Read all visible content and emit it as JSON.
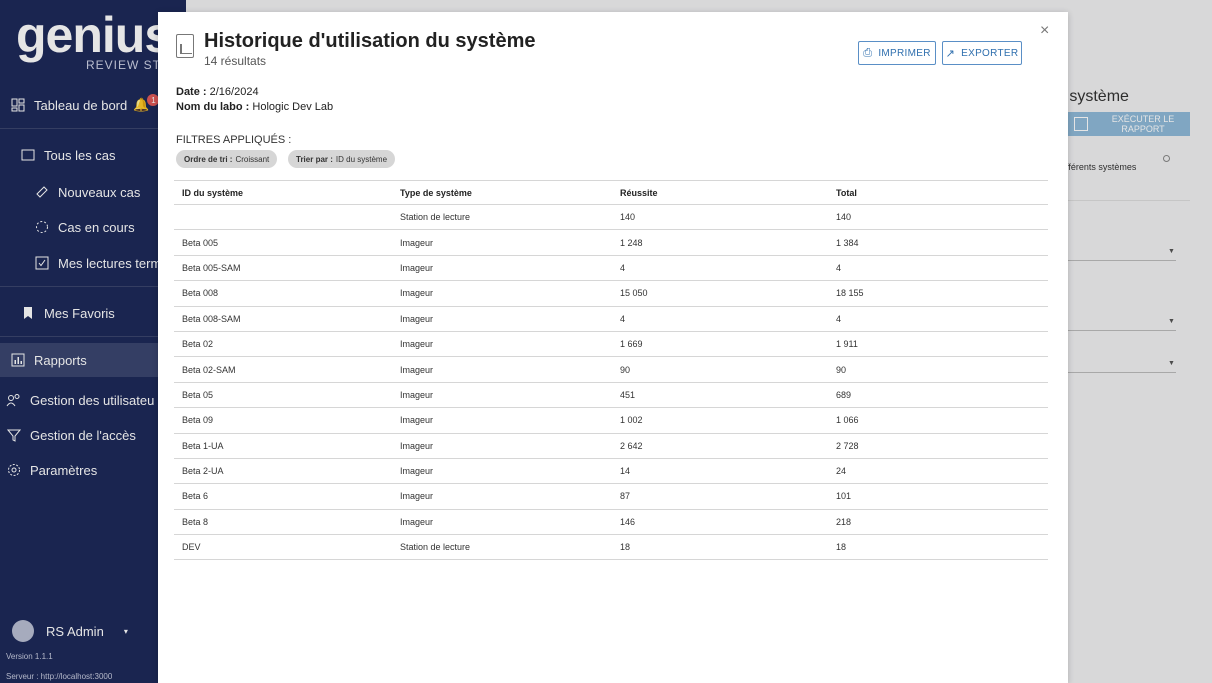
{
  "sidebar": {
    "logo": "genius",
    "logo_sub": "REVIEW STATIC",
    "items": [
      {
        "label": "Tableau de bord",
        "icon": "dashboard-icon"
      },
      {
        "label": "Tous les cas",
        "icon": "folder-icon"
      },
      {
        "label": "Nouveaux cas",
        "icon": "tag-icon"
      },
      {
        "label": "Cas en cours",
        "icon": "progress-icon"
      },
      {
        "label": "Mes lectures termi",
        "icon": "check-icon"
      },
      {
        "label": "Mes Favoris",
        "icon": "bookmark-icon"
      },
      {
        "label": "Rapports",
        "icon": "report-icon"
      },
      {
        "label": "Gestion des utilisateu",
        "icon": "users-icon"
      },
      {
        "label": "Gestion de l'accès",
        "icon": "filter-icon"
      },
      {
        "label": "Paramètres",
        "icon": "gear-icon"
      }
    ],
    "notification_count": "1",
    "user": "RS Admin",
    "version": "Version 1.1.1",
    "server": "Serveur : http://localhost:3000"
  },
  "background": {
    "title": "u système",
    "run_button": "EXÉCUTER LE RAPPORT",
    "option_text": "ifférents systèmes"
  },
  "modal": {
    "title": "Historique d'utilisation du système",
    "subtitle": "14 résultats",
    "print_label": "IMPRIMER",
    "export_label": "EXPORTER",
    "close": "×",
    "date_label": "Date :",
    "date_value": "2/16/2024",
    "lab_label": "Nom du labo :",
    "lab_value": "Hologic Dev Lab",
    "filters_label": "FILTRES APPLIQUÉS :",
    "chips": [
      {
        "key": "Ordre de tri :",
        "value": "Croissant"
      },
      {
        "key": "Trier par :",
        "value": "ID du système"
      }
    ],
    "table": {
      "headers": [
        "ID du système",
        "Type de système",
        "Réussite",
        "Total"
      ],
      "rows": [
        [
          "",
          "Station de lecture",
          "140",
          "140"
        ],
        [
          "Beta 005",
          "Imageur",
          "1 248",
          "1 384"
        ],
        [
          "Beta 005-SAM",
          "Imageur",
          "4",
          "4"
        ],
        [
          "Beta 008",
          "Imageur",
          "15 050",
          "18 155"
        ],
        [
          "Beta 008-SAM",
          "Imageur",
          "4",
          "4"
        ],
        [
          "Beta 02",
          "Imageur",
          "1 669",
          "1 911"
        ],
        [
          "Beta 02-SAM",
          "Imageur",
          "90",
          "90"
        ],
        [
          "Beta 05",
          "Imageur",
          "451",
          "689"
        ],
        [
          "Beta 09",
          "Imageur",
          "1 002",
          "1 066"
        ],
        [
          "Beta 1-UA",
          "Imageur",
          "2 642",
          "2 728"
        ],
        [
          "Beta 2-UA",
          "Imageur",
          "14",
          "24"
        ],
        [
          "Beta 6",
          "Imageur",
          "87",
          "101"
        ],
        [
          "Beta 8",
          "Imageur",
          "146",
          "218"
        ],
        [
          "DEV",
          "Station de lecture",
          "18",
          "18"
        ]
      ]
    }
  },
  "colors": {
    "sidebar_bg": "#1e2a5a",
    "accent": "#2f6fae",
    "run_button": "#8fb9d8"
  }
}
